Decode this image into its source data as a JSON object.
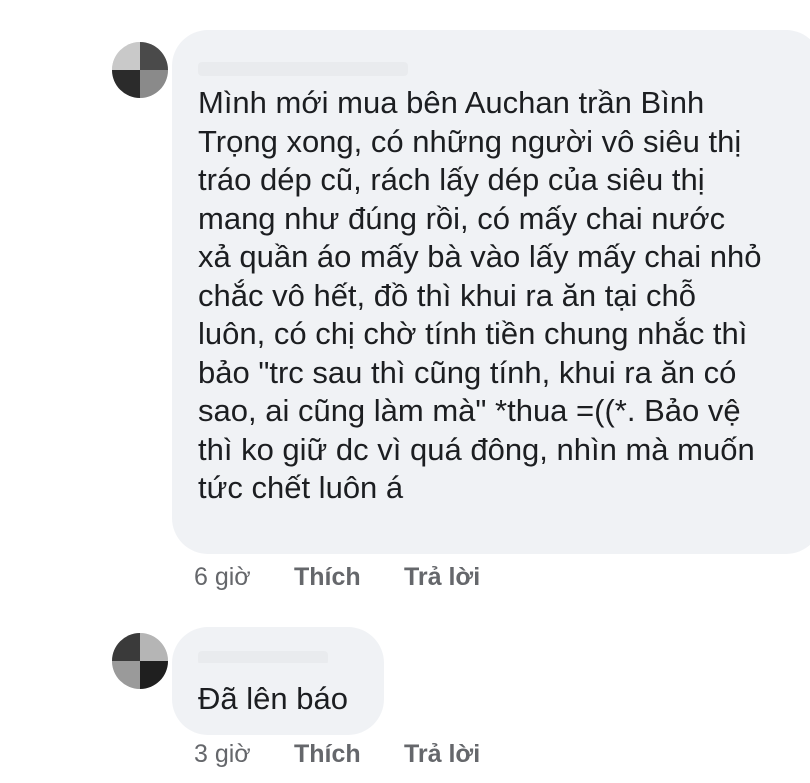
{
  "comments": [
    {
      "author": "",
      "text": "Mình mới mua bên Auchan trần Bình\nTrọng xong, có những người vô siêu thị\ntráo dép cũ, rách lấy dép của siêu thị\nmang như đúng rồi, có mấy chai nước\nxả quần áo mấy bà vào lấy mấy chai nhỏ\nchắc vô hết, đồ thì khui ra ăn tại chỗ\nluôn, có chị chờ tính tiền chung nhắc thì\nbảo \"trc sau thì cũng tính, khui ra ăn có\nsao, ai cũng làm mà\" *thua =((*. Bảo vệ\nthì ko giữ dc vì quá đông, nhìn mà muốn\ntức chết luôn á",
      "time": "6 giờ",
      "like_label": "Thích",
      "reply_label": "Trả lời"
    },
    {
      "author": "",
      "text": "Đã lên báo",
      "time": "3 giờ",
      "like_label": "Thích",
      "reply_label": "Trả lời"
    }
  ]
}
